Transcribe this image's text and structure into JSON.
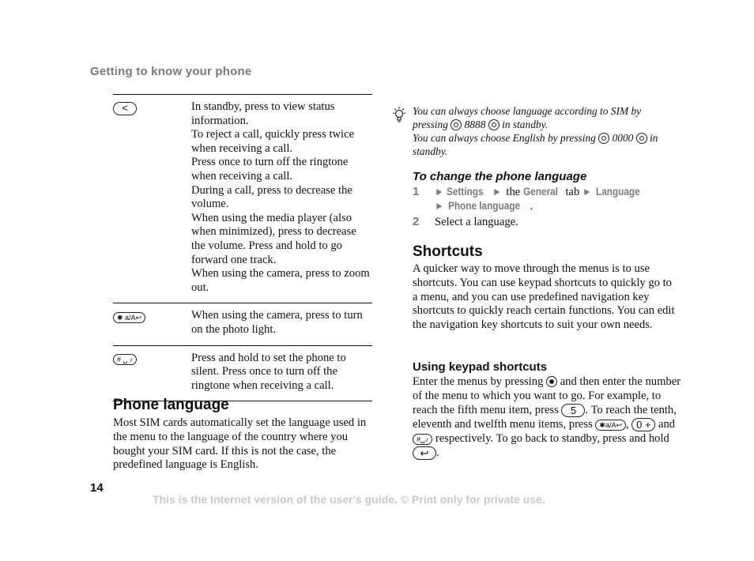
{
  "header": {
    "running_head": "Getting to know your phone"
  },
  "key_table": {
    "rows": [
      {
        "key_icon": "back-key-icon",
        "key_glyph": "<",
        "lines": [
          "In standby, press to view status information.",
          "To reject a call, quickly press twice when receiving a call.",
          "Press once to turn off the ringtone when receiving a call.",
          "During a call, press to decrease the volume.",
          "When using the media player (also when minimized), press to decrease the volume. Press and hold to go forward one track.",
          "When using the camera, press to zoom out."
        ]
      },
      {
        "key_icon": "star-key-icon",
        "key_glyph": "✱ a/A↩",
        "lines": [
          "When using the camera, press to turn on the photo light."
        ]
      },
      {
        "key_icon": "hash-key-icon",
        "key_glyph": "# ␣ ♪",
        "lines": [
          "Press and hold to set the phone to silent. Press once to turn off the ringtone when receiving a call."
        ]
      }
    ]
  },
  "phone_language": {
    "heading": "Phone language",
    "body": "Most SIM cards automatically set the language used in the menu to the language of the country where you bought your SIM card. If this is not the case, the predefined language is English."
  },
  "tip": {
    "icon": "lightbulb-icon",
    "line1_a": "You can always choose language according to SIM by pressing",
    "line1_code": "8888",
    "line1_b": "in standby.",
    "line2_a": "You can always choose English by pressing",
    "line2_code": "0000",
    "line2_b": "in standby."
  },
  "change_language": {
    "heading": "To change the phone language",
    "steps": [
      {
        "num": "1",
        "arrow": "►",
        "settings": "Settings",
        "the": "the",
        "general": "General",
        "tab": "tab",
        "language": "Language",
        "phone_language": "Phone language",
        "period": "."
      },
      {
        "num": "2",
        "text": "Select a language."
      }
    ]
  },
  "shortcuts": {
    "heading": "Shortcuts",
    "body": "A quicker way to move through the menus is to use shortcuts. You can use keypad shortcuts to quickly go to a menu, and you can use predefined navigation key shortcuts to quickly reach certain functions. You can edit the navigation key shortcuts to suit your own needs."
  },
  "keypad_shortcuts": {
    "heading": "Using keypad shortcuts",
    "t1": "Enter the menus by pressing",
    "t2": "and then enter the number of the menu to which you want to go. For example, to reach the fifth menu item, press",
    "key5": "5",
    "t3": ". To reach the tenth, eleventh and twelfth menu items, press",
    "key_star": "✱a/A↩",
    "t4": ",",
    "key0": "0 +",
    "t5": "and",
    "key_hash": "#␣♪",
    "t6": "respectively. To go back to standby, press and hold",
    "key_back": "↩",
    "t7": "."
  },
  "footer": {
    "page_number": "14",
    "note": "This is the Internet version of the user's guide. © Print only for private use."
  }
}
